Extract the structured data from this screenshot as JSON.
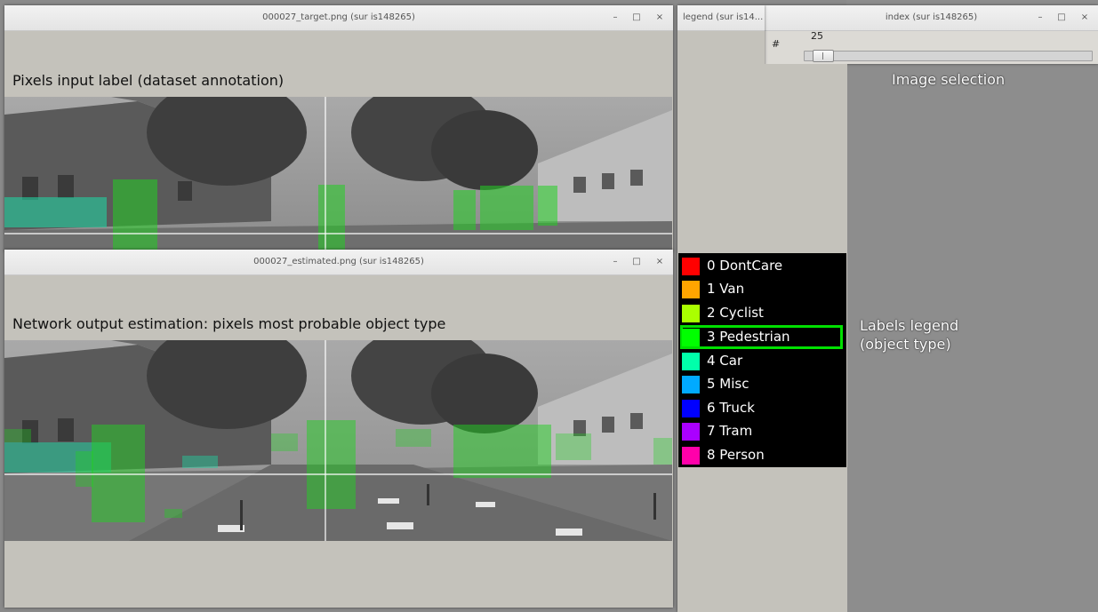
{
  "target_window": {
    "title": "000027_target.png (sur is148265)",
    "annotation": "Pixels input label (dataset annotation)"
  },
  "estimated_window": {
    "title": "000027_estimated.png (sur is148265)",
    "annotation": "Network output estimation: pixels most probable object type"
  },
  "legend_window": {
    "title": "legend (sur is14...",
    "annotation_line1": "Labels legend",
    "annotation_line2": "(object type)",
    "items": [
      {
        "label": "0 DontCare",
        "color": "#ff0000"
      },
      {
        "label": "1 Van",
        "color": "#ffa500"
      },
      {
        "label": "2 Cyclist",
        "color": "#aaff00"
      },
      {
        "label": "3 Pedestrian",
        "color": "#00ff00",
        "selected": true
      },
      {
        "label": "4 Car",
        "color": "#00ffaa"
      },
      {
        "label": "5 Misc",
        "color": "#00aaff"
      },
      {
        "label": "6 Truck",
        "color": "#0000ff"
      },
      {
        "label": "7 Tram",
        "color": "#aa00ff"
      },
      {
        "label": "8 Person",
        "color": "#ff00aa"
      }
    ]
  },
  "index_window": {
    "title": "index (sur is148265)",
    "slider_label": "#",
    "slider_value": "25",
    "slider_fraction": 0.03,
    "annotation": "Image selection"
  },
  "window_controls": {
    "minimize": "–",
    "maximize": "□",
    "close": "×"
  },
  "colors": {
    "window_bg": "#c4c2bb",
    "desktop_bg": "#8a8a8a",
    "pedestrian_overlay": "#22d022",
    "car_overlay": "#22d0a0"
  }
}
